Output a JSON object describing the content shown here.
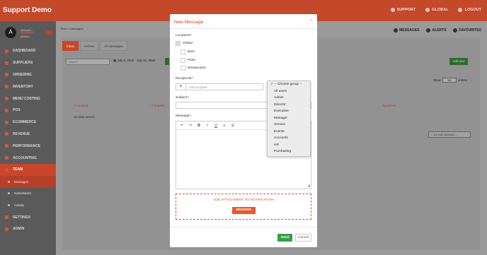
{
  "brand": "Support Demo",
  "topnav": {
    "support": "SUPPORT",
    "global": "GLOBAL",
    "logout": "LOGOUT"
  },
  "profile": {
    "avatar": "A",
    "role": "Welcome",
    "name": "Admin",
    "sub": "(Admin)"
  },
  "sidebar": {
    "items": [
      {
        "label": "DASHBOARD"
      },
      {
        "label": "SUPPLIERS"
      },
      {
        "label": "ORDERING"
      },
      {
        "label": "INVENTORY"
      },
      {
        "label": "MENU COSTING"
      },
      {
        "label": "POS"
      },
      {
        "label": "ECOMMERCE"
      },
      {
        "label": "REVENUE"
      },
      {
        "label": "PERFORMANCE"
      },
      {
        "label": "ACCOUNTING"
      },
      {
        "label": "TEAM"
      },
      {
        "label": "SETTINGS"
      },
      {
        "label": "ADMIN"
      }
    ],
    "subitems": [
      {
        "label": "Messages"
      },
      {
        "label": "Noticeboard"
      },
      {
        "label": "Activity"
      }
    ]
  },
  "breadcrumb": "Team > Messages",
  "rightnav": {
    "messages": "MESSAGES",
    "alerts": "ALERTS",
    "favourites": "FAVOURITES",
    "badge": "1"
  },
  "tabs": [
    {
      "label": "Inbox"
    },
    {
      "label": "Archive"
    },
    {
      "label": "All messages"
    }
  ],
  "search_placeholder": "Search",
  "date_range": "July 8, 2025 - July 15, 2025",
  "add_new": "Add new",
  "show": {
    "label": "Show",
    "value": "50",
    "suffix": "entries"
  },
  "table_headers": [
    "# Created",
    "# Subject",
    "Suppliers"
  ],
  "no_data": "No data search",
  "do_with": "-- Do with selected --",
  "modal": {
    "title": "New Message",
    "close": "×",
    "locations_label": "Locations*:",
    "locations": [
      "Global",
      "Bars",
      "Pubs",
      "Restaurants"
    ],
    "recipients_label": "Recipients*:",
    "recipient_placeholder": "Add recipient",
    "subject_label": "Subject*:",
    "message_label": "Message*:",
    "attachment_text": "ADD ATTACHMENT TO NOTIFICATION",
    "browse": "BROWSE",
    "send": "Send",
    "cancel": "Cancel"
  },
  "group_dropdown": {
    "selected": "-- Choose group --",
    "options": [
      "All users",
      "Admin",
      "Director",
      "Executive",
      "Manager",
      "Service",
      "Events",
      "Accounts",
      "HR",
      "Purchasing"
    ]
  },
  "colors": {
    "accent": "#c9462a",
    "send": "#38a043",
    "browse": "#e7592f"
  }
}
